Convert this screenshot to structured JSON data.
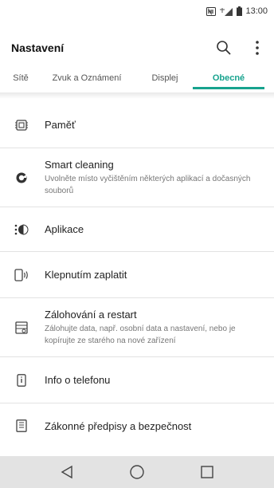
{
  "status_bar": {
    "time": "13:00"
  },
  "header": {
    "title": "Nastavení"
  },
  "tabs": [
    {
      "label": "Sítě",
      "active": false
    },
    {
      "label": "Zvuk a Oznámení",
      "active": false
    },
    {
      "label": "Displej",
      "active": false
    },
    {
      "label": "Obecné",
      "active": true
    }
  ],
  "items": [
    {
      "title": "Paměť",
      "subtitle": "",
      "icon": "memory-chip-icon"
    },
    {
      "title": "Smart cleaning",
      "subtitle": "Uvolněte místo vyčištěním některých aplikací a dočasných souborů",
      "icon": "smart-cleaning-icon"
    },
    {
      "title": "Aplikace",
      "subtitle": "",
      "icon": "apps-icon"
    },
    {
      "title": "Klepnutím zaplatit",
      "subtitle": "",
      "icon": "tap-to-pay-icon"
    },
    {
      "title": "Zálohování a restart",
      "subtitle": "Zálohujte data, např. osobní data a nastavení, nebo je kopírujte ze starého na nové zařízení",
      "icon": "backup-icon"
    },
    {
      "title": "Info o telefonu",
      "subtitle": "",
      "icon": "phone-info-icon"
    },
    {
      "title": "Zákonné předpisy a bezpečnost",
      "subtitle": "",
      "icon": "regulatory-icon"
    }
  ],
  "colors": {
    "accent": "#17a38e",
    "nav_bar": "#e3e3e3"
  }
}
